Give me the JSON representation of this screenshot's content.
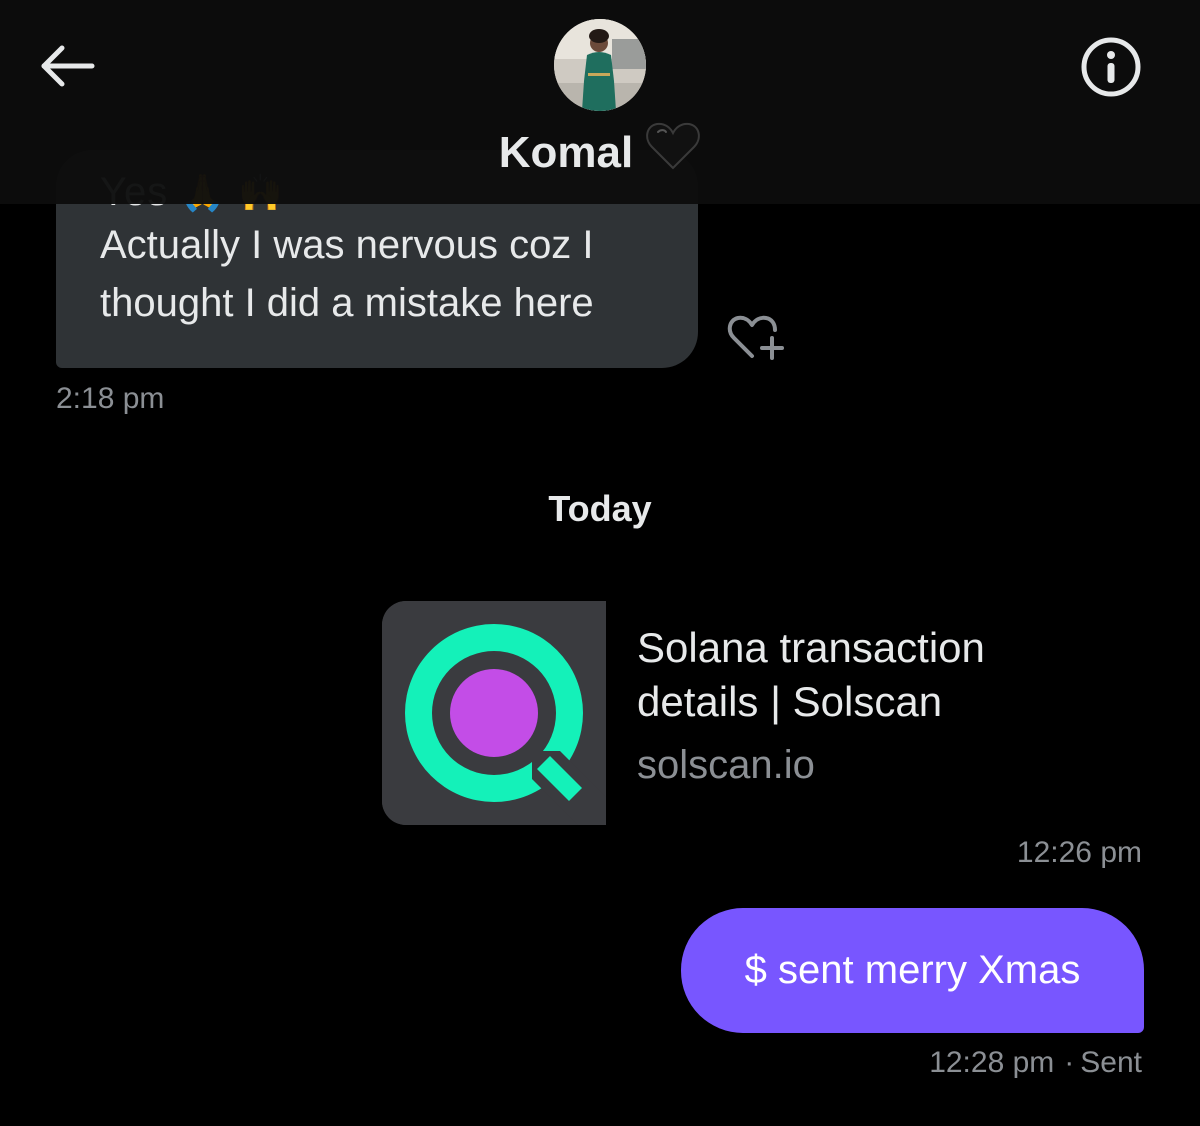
{
  "header": {
    "contact_name": "Komal",
    "name_emoji": "black-heart-icon",
    "back_icon": "arrow-left-icon",
    "info_icon": "info-icon"
  },
  "messages": {
    "received": {
      "partial_line": "Yes",
      "partial_emojis": [
        "folded-hands-emoji",
        "raising-hands-emoji"
      ],
      "text": "Actually I was nervous coz I\nthought I did a mistake here",
      "time": "2:18 pm",
      "reaction_icon": "heart-add-icon"
    },
    "divider": "Today",
    "link_card": {
      "title": "Solana transaction\ndetails | Solscan",
      "domain": "solscan.io",
      "time": "12:26 pm",
      "thumbnail_icon": "solscan-logo-icon"
    },
    "sent": {
      "text": "$ sent merry Xmas",
      "time": "12:28 pm",
      "separator": "·",
      "status": "Sent"
    }
  },
  "colors": {
    "background": "#000000",
    "received_bubble": "#2f3336",
    "sent_bubble": "#7856ff",
    "muted_text": "#8b8f94",
    "solscan_green": "#14f1b9",
    "solscan_purple": "#c34de7"
  }
}
